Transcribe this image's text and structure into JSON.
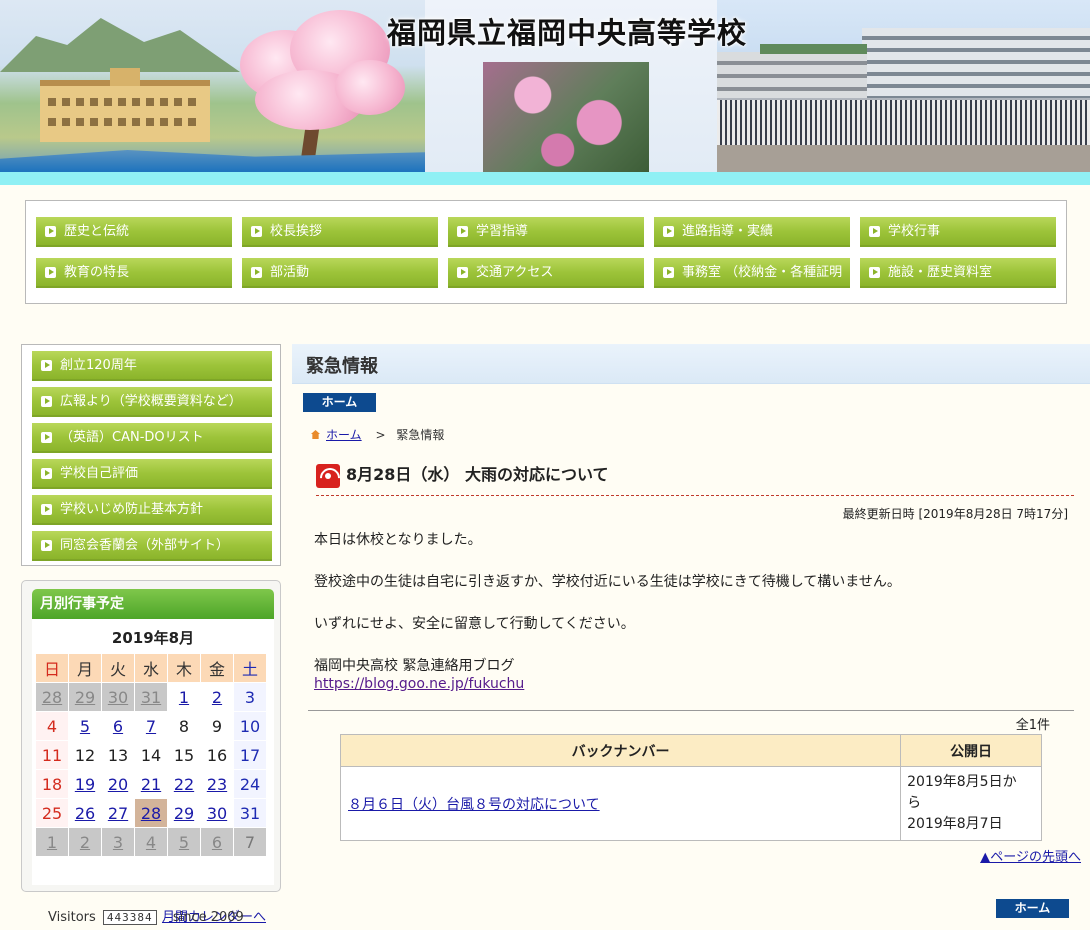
{
  "header": {
    "site_title": "福岡県立福岡中央高等学校"
  },
  "global_nav": {
    "items": [
      {
        "label": "歴史と伝統"
      },
      {
        "label": "校長挨拶"
      },
      {
        "label": "学習指導"
      },
      {
        "label": "進路指導・実績"
      },
      {
        "label": "学校行事"
      },
      {
        "label": "教育の特長"
      },
      {
        "label": "部活動"
      },
      {
        "label": "交通アクセス"
      },
      {
        "label": "事務室 （校納金・各種証明"
      },
      {
        "label": "施設・歴史資料室"
      }
    ]
  },
  "side_menu": {
    "items": [
      {
        "label": "創立120周年"
      },
      {
        "label": "広報より（学校概要資料など）"
      },
      {
        "label": "（英語）CAN-DOリスト"
      },
      {
        "label": "学校自己評価"
      },
      {
        "label": "学校いじめ防止基本方針"
      },
      {
        "label": "同窓会香蘭会（外部サイト）"
      }
    ]
  },
  "calendar": {
    "title": "月別行事予定",
    "month": "2019年8月",
    "weekdays": [
      "日",
      "月",
      "火",
      "水",
      "木",
      "金",
      "土"
    ],
    "weeks": [
      [
        "28",
        "29",
        "30",
        "31",
        "1",
        "2",
        "3"
      ],
      [
        "4",
        "5",
        "6",
        "7",
        "8",
        "9",
        "10"
      ],
      [
        "11",
        "12",
        "13",
        "14",
        "15",
        "16",
        "17"
      ],
      [
        "18",
        "19",
        "20",
        "21",
        "22",
        "23",
        "24"
      ],
      [
        "25",
        "26",
        "27",
        "28",
        "29",
        "30",
        "31"
      ],
      [
        "1",
        "2",
        "3",
        "4",
        "5",
        "6",
        "7"
      ]
    ],
    "link_label": "月間カレンダーへ"
  },
  "visitors": {
    "label": "Visitors",
    "count": "443384",
    "since": "since 2009"
  },
  "main": {
    "heading": "緊急情報",
    "home_button": "ホーム",
    "breadcrumb": {
      "home": "ホーム",
      "separator": ">",
      "current": "緊急情報"
    },
    "article_title": "8月28日（水） 大雨の対応について",
    "updated": "最終更新日時 [2019年8月28日 7時17分]",
    "paragraphs": [
      "本日は休校となりました。",
      "登校途中の生徒は自宅に引き返すか、学校付近にいる生徒は学校にきて待機して構いません。",
      "いずれにせよ、安全に留意して行動してください。",
      "福岡中央高校 緊急連絡用ブログ"
    ],
    "blog_url": "https://blog.goo.ne.jp/fukuchu",
    "total_count": "全1件",
    "backnumber": {
      "col_title": "バックナンバー",
      "col_date": "公開日",
      "rows": [
        {
          "title": "８月６日（火）台風８号の対応について",
          "date_from": "2019年8月5日か",
          "date_mid": "ら",
          "date_to": "2019年8月7日"
        }
      ]
    },
    "page_top": "▲ページの先頭へ",
    "home_button_bottom": "ホーム"
  }
}
